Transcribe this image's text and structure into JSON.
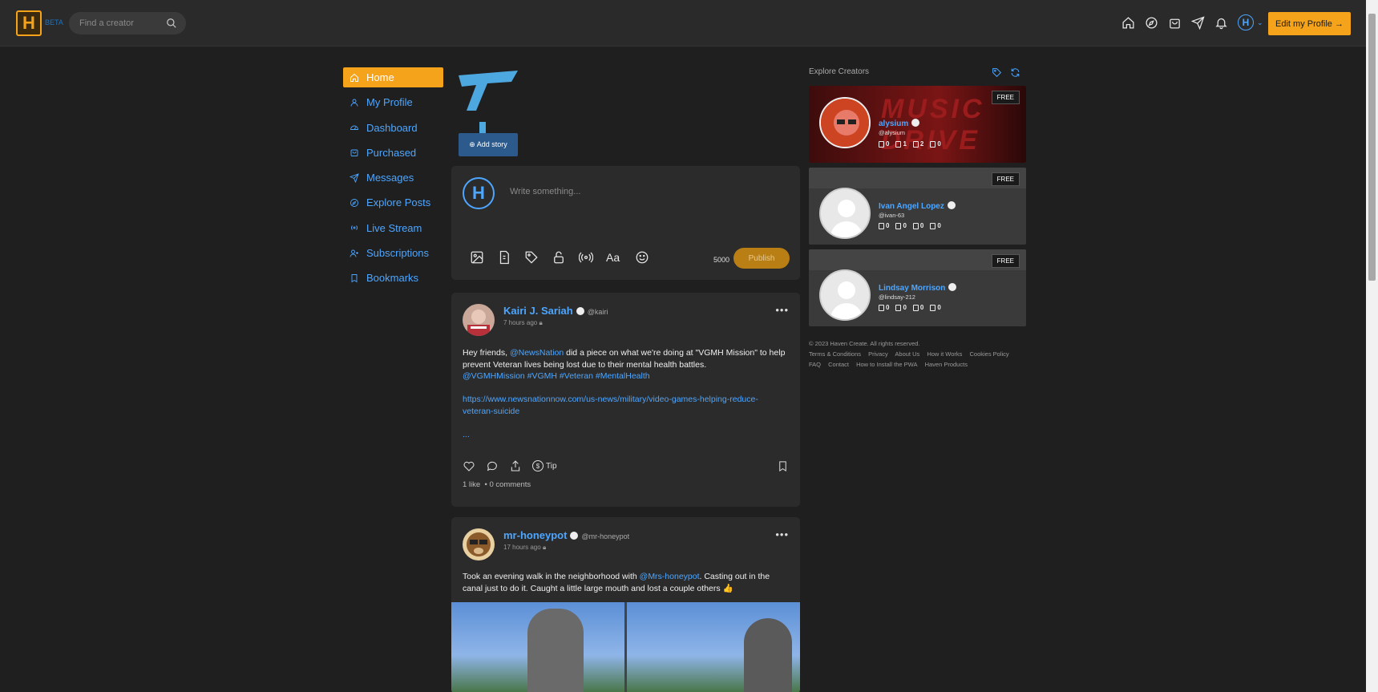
{
  "header": {
    "logo_letter": "H",
    "beta_label": "BETA",
    "search_placeholder": "Find a creator",
    "edit_profile_label": "Edit my Profile →"
  },
  "sidebar": {
    "items": [
      {
        "label": "Home",
        "icon": "home-icon",
        "active": true
      },
      {
        "label": "My Profile",
        "icon": "user-icon"
      },
      {
        "label": "Dashboard",
        "icon": "dashboard-icon"
      },
      {
        "label": "Purchased",
        "icon": "bag-icon"
      },
      {
        "label": "Messages",
        "icon": "send-icon"
      },
      {
        "label": "Explore Posts",
        "icon": "compass-icon"
      },
      {
        "label": "Live Stream",
        "icon": "broadcast-icon"
      },
      {
        "label": "Subscriptions",
        "icon": "user-plus-icon"
      },
      {
        "label": "Bookmarks",
        "icon": "bookmark-icon"
      }
    ]
  },
  "story": {
    "add_label": "⊕ Add story"
  },
  "composer": {
    "placeholder": "Write something...",
    "char_count": "5000",
    "publish_label": "Publish",
    "aa_label": "Aa"
  },
  "posts": [
    {
      "name": "Kairi J. Sariah",
      "handle": "@kairi",
      "time": "7 hours ago",
      "body_pre": "Hey friends, ",
      "mention": "@NewsNation",
      "body_post": " did a piece on what we're doing at \"VGMH Mission\" to help prevent Veteran lives being lost due to their mental health battles.",
      "tags": "@VGMHMission #VGMH #Veteran #MentalHealth",
      "url": "https://www.newsnationnow.com/us-news/military/video-games-helping-reduce-veteran-suicide",
      "more": "...",
      "tip_label": "Tip",
      "likes": "1 like",
      "comments": "0 comments"
    },
    {
      "name": "mr-honeypot",
      "handle": "@mr-honeypot",
      "time": "17 hours ago",
      "body_pre": "Took an evening walk in the neighborhood with ",
      "mention": "@Mrs-honeypot",
      "body_post": ". Casting out in the canal just to do it. Caught a little large mouth and lost a couple others 👍"
    }
  ],
  "explore": {
    "title": "Explore Creators",
    "free_label": "FREE",
    "creators": [
      {
        "name": "alysium",
        "handle": "@alysium",
        "stats": [
          "0",
          "1",
          "2",
          "0"
        ],
        "banner_text": "MUSIC DRIVE"
      },
      {
        "name": "Ivan Angel Lopez",
        "handle": "@ivan-63",
        "stats": [
          "0",
          "0",
          "0",
          "0"
        ]
      },
      {
        "name": "Lindsay Morrison",
        "handle": "@lindsay-212",
        "stats": [
          "0",
          "0",
          "0",
          "0"
        ]
      }
    ]
  },
  "footer": {
    "copyright": "© 2023 Haven Create. All rights reserved.",
    "links_row1": [
      "Terms & Conditions",
      "Privacy",
      "About Us",
      "How it Works",
      "Cookies Policy"
    ],
    "links_row2": [
      "FAQ",
      "Contact",
      "How to Install the PWA",
      "Haven Products"
    ]
  },
  "colors": {
    "accent": "#f5a31a",
    "link": "#4da6ff",
    "bg": "#1f1f1f",
    "panel": "#2b2b2b"
  }
}
